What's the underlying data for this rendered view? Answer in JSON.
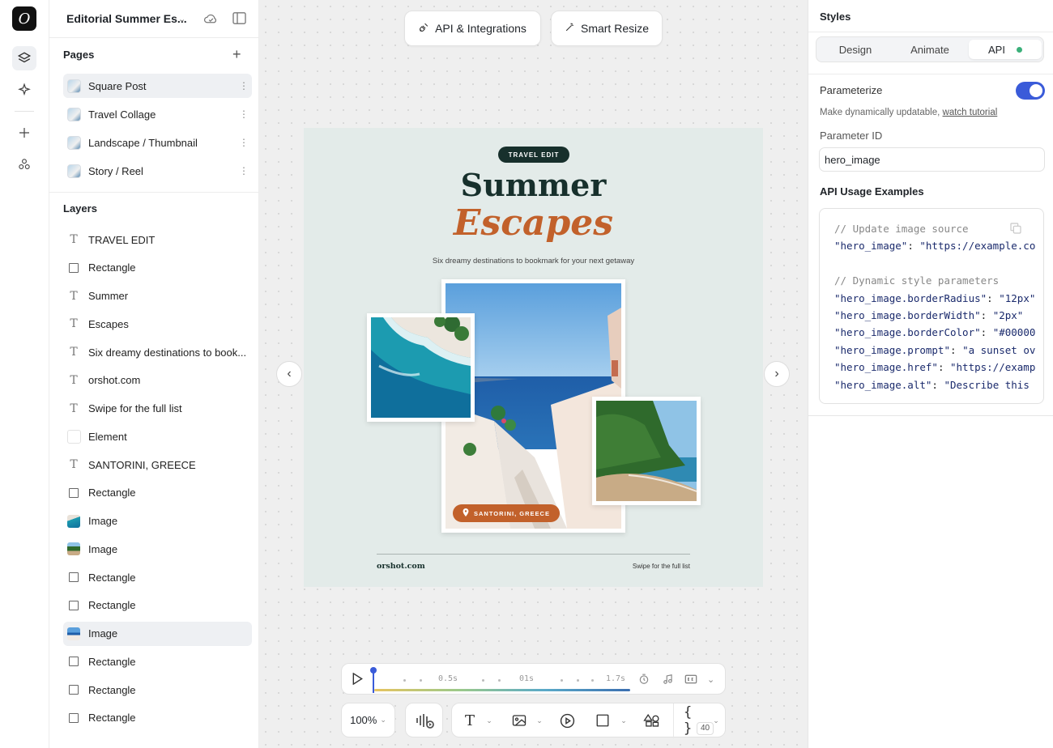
{
  "project": {
    "title": "Editorial Summer Es..."
  },
  "pages": {
    "heading": "Pages",
    "items": [
      {
        "label": "Square Post",
        "selected": true
      },
      {
        "label": "Travel Collage"
      },
      {
        "label": "Landscape / Thumbnail"
      },
      {
        "label": "Story / Reel"
      }
    ]
  },
  "layers": {
    "heading": "Layers",
    "items": [
      {
        "label": "TRAVEL EDIT",
        "kind": "text"
      },
      {
        "label": "Rectangle",
        "kind": "rect"
      },
      {
        "label": "Summer",
        "kind": "text"
      },
      {
        "label": "Escapes",
        "kind": "text"
      },
      {
        "label": "Six dreamy destinations to book...",
        "kind": "text"
      },
      {
        "label": "orshot.com",
        "kind": "text"
      },
      {
        "label": "Swipe for the full list",
        "kind": "text"
      },
      {
        "label": "Element",
        "kind": "element"
      },
      {
        "label": "SANTORINI, GREECE",
        "kind": "text"
      },
      {
        "label": "Rectangle",
        "kind": "rect"
      },
      {
        "label": "Image",
        "kind": "image-sea"
      },
      {
        "label": "Image",
        "kind": "image-beach"
      },
      {
        "label": "Rectangle",
        "kind": "rect"
      },
      {
        "label": "Rectangle",
        "kind": "rect"
      },
      {
        "label": "Image",
        "kind": "image-greece",
        "selected": true
      },
      {
        "label": "Rectangle",
        "kind": "rect"
      },
      {
        "label": "Rectangle",
        "kind": "rect"
      },
      {
        "label": "Rectangle",
        "kind": "rect"
      }
    ]
  },
  "canvas": {
    "top_buttons": {
      "api": "API & Integrations",
      "resize": "Smart Resize"
    },
    "artboard": {
      "pill": "TRAVEL EDIT",
      "title_1": "Summer",
      "title_2": "Escapes",
      "subtitle": "Six dreamy destinations to bookmark for your next getaway",
      "location": "SANTORINI, GREECE",
      "footer_left": "orshot.com",
      "footer_right": "Swipe for the full list"
    },
    "timeline": {
      "marks": [
        "0.5s",
        "01s",
        "1.7s"
      ],
      "progress": 0.0
    },
    "zoom": "100%",
    "badge_count": "40"
  },
  "panel": {
    "title": "Styles",
    "tabs": [
      "Design",
      "Animate",
      "API"
    ],
    "active_tab": "API",
    "parameterize_label": "Parameterize",
    "parameterize_on": true,
    "help_text": "Make dynamically updatable,",
    "help_link": "watch tutorial",
    "param_id_label": "Parameter ID",
    "param_id_value": "hero_image",
    "examples_heading": "API Usage Examples",
    "code_lines": [
      {
        "t": "comment",
        "text": "// Update image source"
      },
      {
        "t": "kv",
        "key": "\"hero_image\"",
        "val": "\"https://example.co"
      },
      {
        "t": "blank",
        "text": ""
      },
      {
        "t": "comment",
        "text": "// Dynamic style parameters"
      },
      {
        "t": "kv",
        "key": "\"hero_image.borderRadius\"",
        "val": "\"12px\""
      },
      {
        "t": "kv",
        "key": "\"hero_image.borderWidth\"",
        "val": "\"2px\""
      },
      {
        "t": "kv",
        "key": "\"hero_image.borderColor\"",
        "val": "\"#00000"
      },
      {
        "t": "kv",
        "key": "\"hero_image.prompt\"",
        "val": "\"a sunset ov"
      },
      {
        "t": "kv",
        "key": "\"hero_image.href\"",
        "val": "\"https://examp"
      },
      {
        "t": "kv",
        "key": "\"hero_image.alt\"",
        "val": "\"Describe this"
      }
    ]
  },
  "colors": {
    "accent": "#3a5bd9",
    "brand_dark": "#17302c",
    "brand_orange": "#c2612b",
    "status_green": "#3bb07a"
  }
}
